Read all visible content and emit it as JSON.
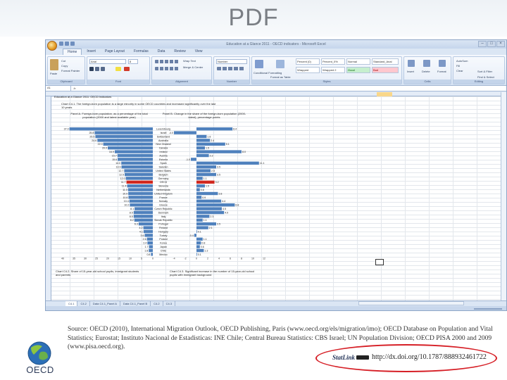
{
  "slide": {
    "title": "PDF"
  },
  "excel": {
    "window_title": "Education at a Glance 2011 - OECD indicators - Microsoft Excel",
    "tabs": [
      "Home",
      "Insert",
      "Page Layout",
      "Formulas",
      "Data",
      "Review",
      "View"
    ],
    "ribbon": {
      "clipboard": {
        "label": "Clipboard",
        "paste": "Paste",
        "cut": "Cut",
        "copy": "Copy",
        "format_painter": "Format Painter"
      },
      "font": {
        "label": "Font",
        "name": "Arial",
        "size": "8"
      },
      "alignment": {
        "label": "Alignment",
        "wrap": "Wrap Text",
        "merge": "Merge & Center"
      },
      "number": {
        "label": "Number",
        "format": "Number"
      },
      "styles": {
        "label": "Styles",
        "conditional": "Conditional Formatting",
        "format_table": "Format as Table",
        "cells": [
          "Percent (0)",
          "Percent_0%",
          "Normal",
          "Standard_Anal",
          "Wrapped",
          "Wrapped 2",
          "Good",
          "Bad"
        ]
      },
      "cells": {
        "label": "Cells",
        "insert": "Insert",
        "delete": "Delete",
        "format": "Format"
      },
      "editing": {
        "label": "Editing",
        "autosum": "AutoSum",
        "fill": "Fill",
        "clear": "Clear",
        "sort": "Sort & Filter",
        "find": "Find & Select"
      }
    },
    "name_box": "A1",
    "formula_icon": "fx",
    "sheet_title": "Education at a Glance 2011: OECD Indicators",
    "chart_caption": "Chart C4.1. The foreign-born population is a large minority in some OECD countries and increased significantly over the last 10 years",
    "left_panel_title": "Panel A. Foreign-born population, as a percentage of the total population (2000 and latest available year)",
    "right_panel_title": "Panel B. Change in the share of the foreign-born population (2000-latest), percentage points",
    "lower_left_title": "Chart C4.2. Share of 15-year-old school pupils, immigrant students and parents",
    "lower_right_title": "Chart C4.3. Significant increase in the number of 15-year-old school pupils with immigrant background",
    "sheet_tabs": [
      "C4.1",
      "C4.2",
      "Data C4.1_Panel A",
      "Data C4.1_Panel B",
      "C4.2",
      "C4.3"
    ],
    "active_sheet": "C4.1"
  },
  "chart_data": [
    {
      "type": "bar",
      "title": "",
      "categories": [
        "Luxembourg",
        "Israel",
        "Switzerland",
        "Australia",
        "New Zealand",
        "Canada",
        "Ireland",
        "Austria",
        "Estonia",
        "Spain",
        "Sweden",
        "United States",
        "Belgium",
        "Germany",
        "OECD",
        "Slovenia",
        "Netherlands",
        "United Kingdom",
        "France",
        "Norway",
        "Greece",
        "Czech Republic",
        "Denmark",
        "Italy",
        "Slovak Republic",
        "Portugal",
        "Finland",
        "Hungary",
        "Turkey",
        "Poland",
        "Korea",
        "Japan",
        "Chile",
        "Mexico"
      ],
      "values": [
        37.0,
        25.8,
        25.5,
        24.6,
        22.0,
        20.0,
        16.9,
        15.7,
        15.6,
        14.0,
        13.9,
        12.7,
        12.5,
        12.0,
        11.7,
        11.4,
        11.0,
        10.9,
        10.8,
        10.4,
        10.2,
        8.1,
        8.5,
        8.5,
        8.2,
        6.3,
        4.2,
        4.1,
        3.6,
        2.6,
        2.4,
        1.7,
        1.8,
        0.8
      ],
      "highlight": "OECD",
      "bar_color": "#4f81bd",
      "highlight_color": "#d0281f",
      "xlim": [
        0,
        40
      ],
      "xticks": [
        "40",
        "35",
        "30",
        "25",
        "20",
        "15",
        "10",
        "5",
        "0"
      ]
    },
    {
      "type": "bar",
      "title": "",
      "categories": [
        "Luxembourg",
        "Israel",
        "Switzerland",
        "Australia",
        "New Zealand",
        "Canada",
        "Ireland",
        "Austria",
        "Estonia",
        "Spain",
        "Sweden",
        "United States",
        "Belgium",
        "Germany",
        "OECD",
        "Slovenia",
        "Netherlands",
        "United Kingdom",
        "France",
        "Norway",
        "Greece",
        "Czech Republic",
        "Denmark",
        "Italy",
        "Slovak Republic",
        "Portugal",
        "Finland",
        "Hungary",
        "Turkey",
        "Poland",
        "Korea",
        "Japan",
        "Chile",
        "Mexico"
      ],
      "values": [
        6.4,
        -4.0,
        1.8,
        2.4,
        5.1,
        1.5,
        8.0,
        2.2,
        -1.0,
        11.1,
        3.5,
        2.5,
        3.5,
        1.1,
        3.2,
        1.5,
        0.6,
        3.8,
        0.9,
        4.4,
        6.8,
        4.5,
        4.9,
        2.3,
        1.1,
        3.5,
        2.1,
        0.1,
        -0.4,
        1.1,
        0.8,
        0.6,
        1.3,
        0.1
      ],
      "highlight": "OECD",
      "bar_color": "#4f81bd",
      "highlight_color": "#d0281f",
      "xlim": [
        -4,
        12
      ],
      "xticks": [
        "-4",
        "-2",
        "0",
        "2",
        "4",
        "6",
        "8",
        "10",
        "12"
      ]
    }
  ],
  "source": {
    "text": "Source: OECD (2010), International Migration Outlook, OECD Publishing, Paris (www.oecd.org/els/migration/imo); OECD Database on Population and Vital Statistics; Eurostat; Instituto Nacional de Estadisticas: INE Chile; Central Bureau Statistics: CBS Israel; UN Population Division; OECD PISA 2000 and 2009 (www.pisa.oecd.org)."
  },
  "logo": {
    "text": "OECD",
    "icon": "oecd-globe-icon"
  },
  "statlink": {
    "logo_text": "StatLink",
    "arrow_icon": "arrow-right-icon",
    "url": "http://dx.doi.org/10.1787/888932461722"
  },
  "colors": {
    "accent_red": "#d61f26",
    "excel_blue": "#4f81bd"
  }
}
